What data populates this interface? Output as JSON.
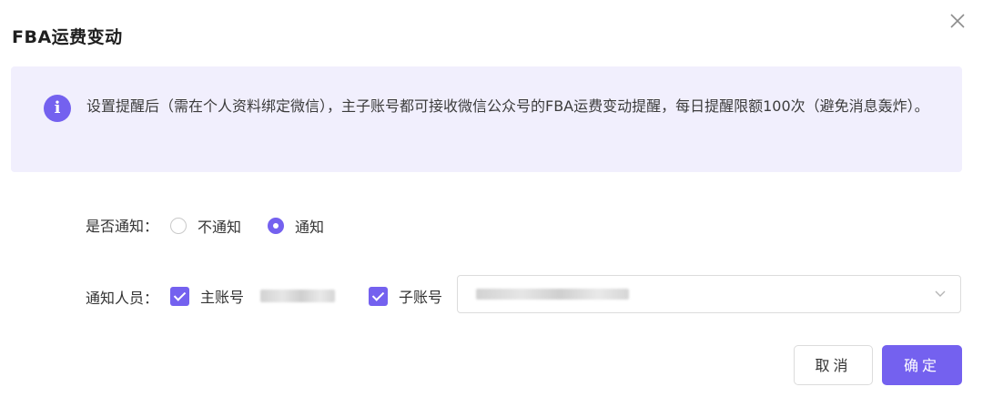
{
  "dialog": {
    "title": "FBA运费变动",
    "close_icon": "close-icon"
  },
  "notice": {
    "icon": "info-icon",
    "icon_glyph": "i",
    "text": "设置提醒后（需在个人资料绑定微信），主子账号都可接收微信公众号的FBA运费变动提醒，每日提醒限额100次（避免消息轰炸）。"
  },
  "notify_row": {
    "label": "是否通知：",
    "options": [
      {
        "label": "不通知",
        "selected": false
      },
      {
        "label": "通知",
        "selected": true
      }
    ]
  },
  "people_row": {
    "label": "通知人员：",
    "main_account": {
      "label": "主账号",
      "checked": true
    },
    "sub_account": {
      "label": "子账号",
      "checked": true
    },
    "select_chevron_icon": "chevron-down-icon"
  },
  "footer": {
    "cancel_label": "取消",
    "ok_label": "确定"
  },
  "colors": {
    "accent": "#7461ef",
    "notice_bg": "#f1effd"
  }
}
